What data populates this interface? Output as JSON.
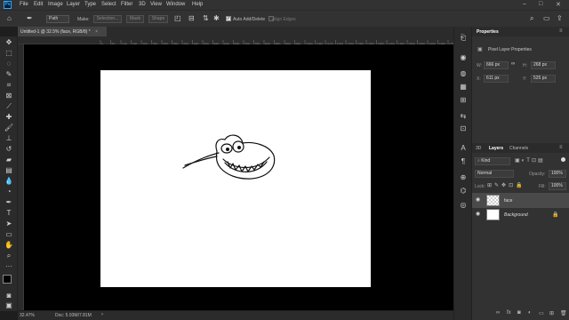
{
  "app": {
    "logo": "Ps"
  },
  "menu": [
    "File",
    "Edit",
    "Image",
    "Layer",
    "Type",
    "Select",
    "Filter",
    "3D",
    "View",
    "Window",
    "Help"
  ],
  "options": {
    "mode_value": "Path",
    "make_label": "Make:",
    "selection_label": "Selection...",
    "mask_label": "Mask",
    "shape_label": "Shape",
    "auto_add_label": "Auto Add/Delete",
    "align_edges_label": "Align Edges"
  },
  "document": {
    "tab_title": "Untitled-1 @ 32.5% (face, RGB/8) *"
  },
  "ruler_ticks": [
    "0",
    "50",
    "100",
    "150",
    "200",
    "250",
    "300",
    "350",
    "400",
    "450",
    "500",
    "550",
    "600",
    "650",
    "700",
    "750",
    "800",
    "850",
    "900",
    "950",
    "1000",
    "1050",
    "1100",
    "1150",
    "1200",
    "1250",
    "1300",
    "1350",
    "1400",
    "1450",
    "1500",
    "1550",
    "1600",
    "1650",
    "1700",
    "1750",
    "1800",
    "1850",
    "1900",
    "1950",
    "2000"
  ],
  "status": {
    "zoom": "32.47%",
    "doc_info": "Doc: 5.93M/7.81M"
  },
  "properties": {
    "tab": "Properties",
    "subtitle": "Pixel Layer Properties",
    "w_label": "W:",
    "w_value": "666 px",
    "h_label": "H:",
    "h_value": "268 px",
    "x_label": "X:",
    "x_value": "611 px",
    "y_label": "Y:",
    "y_value": "525 px"
  },
  "layers_panel": {
    "tabs": [
      "3D",
      "Layers",
      "Channels"
    ],
    "filter_value": "Kind",
    "blend_mode": "Normal",
    "opacity_label": "Opacity:",
    "opacity_value": "100%",
    "lock_label": "Lock:",
    "fill_label": "Fill:",
    "fill_value": "100%",
    "layers": [
      {
        "name": "face"
      },
      {
        "name": "Background"
      }
    ]
  },
  "colors": {
    "accent": "#31a8ff",
    "canvas": "#ffffff",
    "workspace": "#000000",
    "panel": "#323232"
  }
}
